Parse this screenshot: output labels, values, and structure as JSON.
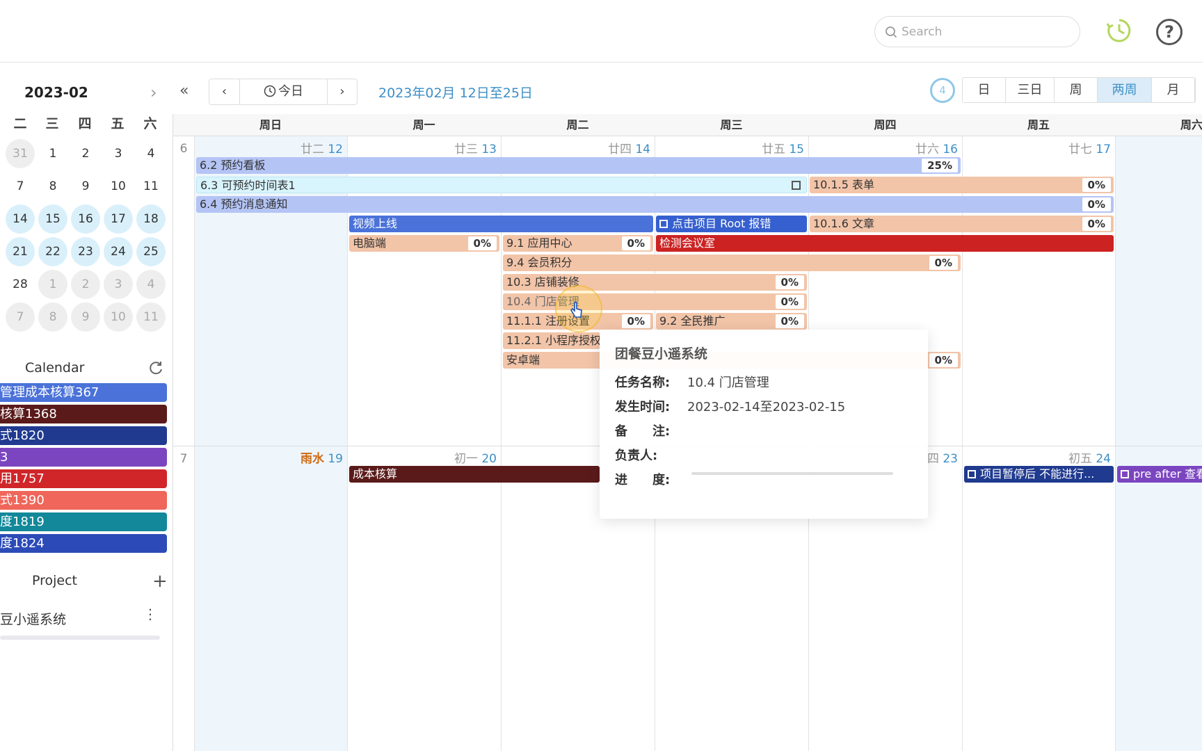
{
  "header": {
    "search_placeholder": "Search",
    "clock_icon": "clock-icon",
    "help_icon": "help-icon",
    "help_label": "?"
  },
  "mini_calendar": {
    "title": "2023-02",
    "next_label": "›",
    "weekdays": [
      "二",
      "三",
      "四",
      "五",
      "六"
    ],
    "rows": [
      [
        "31",
        "1",
        "2",
        "3",
        "4"
      ],
      [
        "7",
        "8",
        "9",
        "10",
        "11"
      ],
      [
        "14",
        "15",
        "16",
        "17",
        "18"
      ],
      [
        "21",
        "22",
        "23",
        "24",
        "25"
      ],
      [
        "28",
        "1",
        "2",
        "3",
        "4"
      ],
      [
        "7",
        "8",
        "9",
        "10",
        "11"
      ]
    ]
  },
  "calendar_section": {
    "title": "Calendar",
    "items": [
      {
        "label": "管理成本核算367",
        "color": "#4a72d9"
      },
      {
        "label": "核算1368",
        "color": "#5a1a1a"
      },
      {
        "label": "式1820",
        "color": "#1f3a8f"
      },
      {
        "label": "3",
        "color": "#7b45c0"
      },
      {
        "label": "用1757",
        "color": "#d0262a"
      },
      {
        "label": "式1390",
        "color": "#f0665a"
      },
      {
        "label": "度1819",
        "color": "#12889a"
      },
      {
        "label": "度1824",
        "color": "#2c4bb8"
      }
    ]
  },
  "project_section": {
    "title": "Project",
    "add_label": "+",
    "item_label": "豆小遥系统",
    "more_label": "⋮"
  },
  "toolbar": {
    "collapse_label": "«",
    "prev_label": "‹",
    "today_label": "今日",
    "next_label": "›",
    "range_label": "2023年02月 12日至25日",
    "badge": "4",
    "views": [
      "日",
      "三日",
      "周",
      "两周",
      "月"
    ],
    "active_view": "两周"
  },
  "grid": {
    "day_headers": [
      "周日",
      "周一",
      "周二",
      "周三",
      "周四",
      "周五",
      "周六"
    ],
    "week1": {
      "num": "6",
      "dates": [
        {
          "lunar": "廿二",
          "day": "12"
        },
        {
          "lunar": "廿三",
          "day": "13"
        },
        {
          "lunar": "廿四",
          "day": "14"
        },
        {
          "lunar": "廿五",
          "day": "15"
        },
        {
          "lunar": "廿六",
          "day": "16"
        },
        {
          "lunar": "廿七",
          "day": "17"
        }
      ]
    },
    "week2": {
      "num": "7",
      "dates": [
        {
          "lunar": "雨水",
          "day": "19",
          "term": true
        },
        {
          "lunar": "初一",
          "day": "20"
        },
        {
          "lunar": "",
          "day": ""
        },
        {
          "lunar": "",
          "day": ""
        },
        {
          "lunar": "四",
          "day": "23"
        },
        {
          "lunar": "初五",
          "day": "24"
        }
      ]
    }
  },
  "events": [
    {
      "label": "6.2 预约看板",
      "pct": "25%",
      "color": "#b4c4f5"
    },
    {
      "label": "6.3 可预约时间表1",
      "color": "#d8f4fc"
    },
    {
      "label": "10.1.5 表单",
      "pct": "0%",
      "color": "#f2c4a8"
    },
    {
      "label": "6.4 预约消息通知",
      "pct": "0%",
      "color": "#b4c4f5"
    },
    {
      "label": "视频上线",
      "color": "#4a72d9"
    },
    {
      "label": "点击项目 Root 报错",
      "color": "#3660cf"
    },
    {
      "label": "10.1.6 文章",
      "pct": "0%",
      "color": "#f2c4a8"
    },
    {
      "label": "电脑端",
      "pct": "0%",
      "color": "#f2c4a8"
    },
    {
      "label": "9.1 应用中心",
      "pct": "0%",
      "color": "#f2c4a8"
    },
    {
      "label": "检测会议室",
      "color": "#cc2222"
    },
    {
      "label": "9.4 会员积分",
      "pct": "0%",
      "color": "#f2c4a8"
    },
    {
      "label": "10.3 店铺装修",
      "pct": "0%",
      "color": "#f2c4a8"
    },
    {
      "label": "10.4 门店管理",
      "pct": "0%",
      "color": "#f2c4a8"
    },
    {
      "label": "11.1.1 注册设置",
      "pct": "0%",
      "color": "#f2c4a8"
    },
    {
      "label": "9.2 全民推广",
      "pct": "0%",
      "color": "#f2c4a8"
    },
    {
      "label": "11.2.1 小程序授权",
      "color": "#f2c4a8"
    },
    {
      "label": "安卓端",
      "pct": "0%",
      "color": "#f2c4a8"
    },
    {
      "label": "成本核算",
      "color": "#5a1a1a"
    },
    {
      "label": "项目暂停后 不能进行...",
      "color": "#1f3a8f"
    },
    {
      "label": "pre after 查看",
      "color": "#7b45c0"
    }
  ],
  "tooltip": {
    "title": "团餐豆小遥系统",
    "rows": [
      {
        "k": "任务名称:",
        "v": "10.4 门店管理"
      },
      {
        "k": "发生时间:",
        "v": "2023-02-14至2023-02-15"
      },
      {
        "k": "备　　注:",
        "v": ""
      },
      {
        "k": "负责人:",
        "v": ""
      },
      {
        "k": "进　　度:",
        "v": ""
      }
    ]
  }
}
